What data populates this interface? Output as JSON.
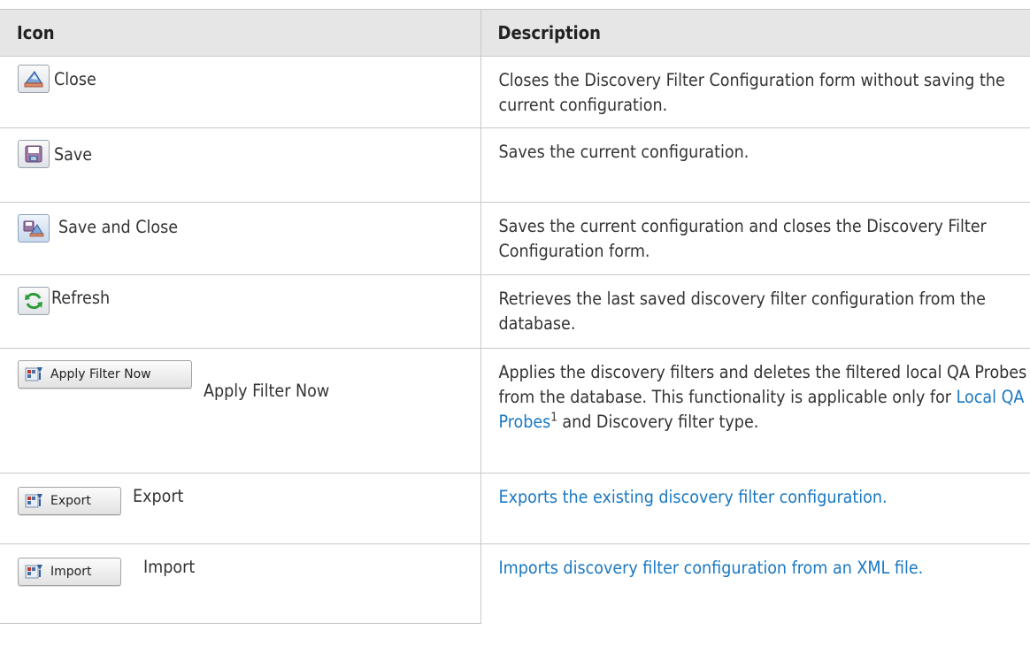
{
  "table": {
    "headers": {
      "icon": "Icon",
      "description": "Description"
    },
    "rows": [
      {
        "label": "Close",
        "icon": "close-icon",
        "description": "Closes the Discovery Filter Configuration form without saving the current configuration."
      },
      {
        "label": "Save",
        "icon": "save-icon",
        "description": "Saves the current configuration."
      },
      {
        "label": "Save and Close",
        "icon": "save-and-close-icon",
        "description": "Saves the current configuration and closes the Discovery Filter Configuration form."
      },
      {
        "label": "Refresh",
        "icon": "refresh-icon",
        "description": "Retrieves the last saved discovery filter configuration from the database."
      },
      {
        "label": "Apply Filter Now",
        "icon": "apply-filter-icon",
        "button_text": "Apply Filter Now",
        "description_before": "Applies the discovery filters and deletes the filtered local QA Probes from the database. This functionality is applicable only for ",
        "description_link": "Local QA Probes",
        "footnote": "1",
        "description_after": " and Discovery filter type."
      },
      {
        "label": "Export",
        "icon": "export-icon",
        "button_text": "Export",
        "description": "Exports the existing discovery filter configuration."
      },
      {
        "label": "Import",
        "icon": "import-icon",
        "button_text": "Import",
        "description": "Imports discovery filter configuration from an XML file."
      }
    ]
  },
  "colors": {
    "header_bg": "#e6e6e6",
    "link": "#1a78c2",
    "text": "#333333",
    "border": "#c8c8c8"
  }
}
